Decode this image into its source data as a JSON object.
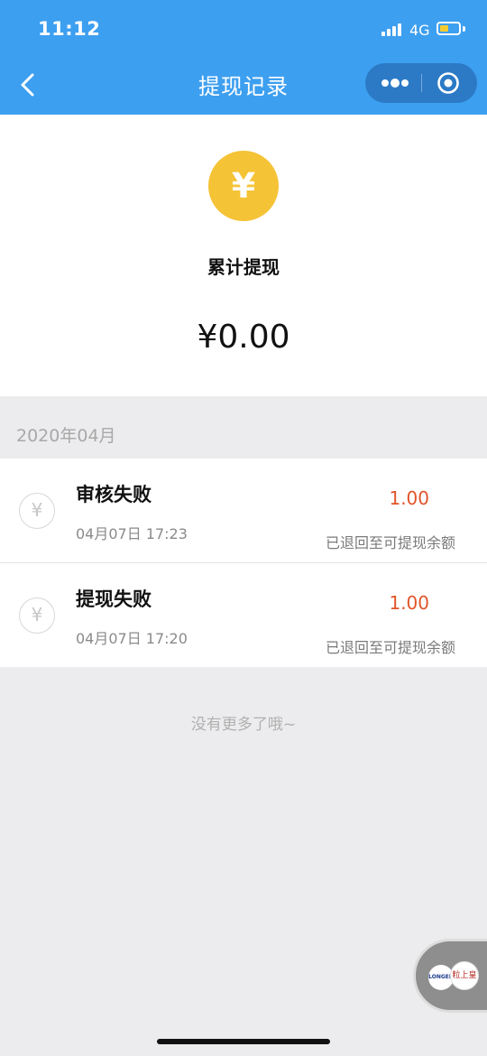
{
  "status_bar": {
    "time": "11:12",
    "network": "4G"
  },
  "nav": {
    "title": "提现记录"
  },
  "summary": {
    "icon_symbol": "¥",
    "label": "累计提现",
    "amount": "¥0.00"
  },
  "month_header": "2020年04月",
  "records": [
    {
      "icon_symbol": "¥",
      "title": "审核失败",
      "time": "04月07日 17:23",
      "amount": "1.00",
      "note": "已退回至可提现余额"
    },
    {
      "icon_symbol": "¥",
      "title": "提现失败",
      "time": "04月07日 17:20",
      "amount": "1.00",
      "note": "已退回至可提现余额"
    }
  ],
  "footer_text": "没有更多了哦~",
  "float_badge": {
    "logo_a": "LONGEN",
    "logo_b": "粒上皇"
  },
  "colors": {
    "nav_bg": "#3d9ff0",
    "coin": "#f5c336",
    "amount_red": "#e0552a",
    "page_bg": "#ececee"
  },
  "icons": [
    "back-arrow-icon",
    "more-dots-icon",
    "close-target-icon",
    "yuan-coin-icon",
    "signal-icon",
    "battery-icon"
  ]
}
